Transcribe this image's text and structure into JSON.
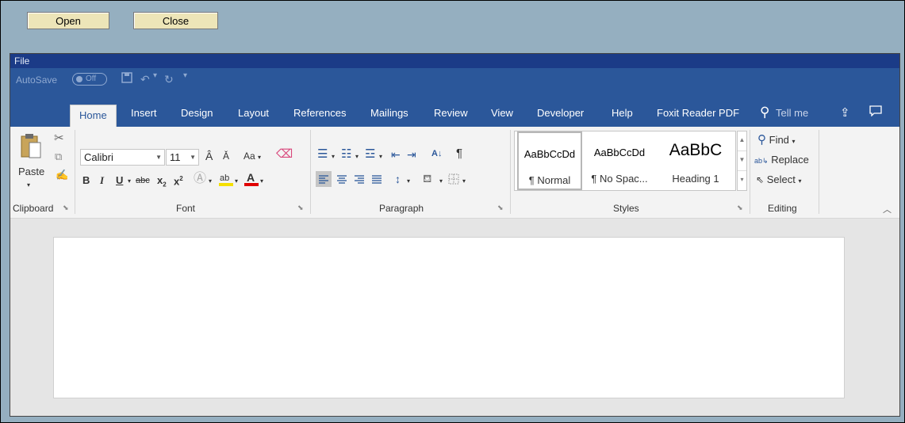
{
  "outer": {
    "open_label": "Open",
    "close_label": "Close"
  },
  "word": {
    "file_label": "File",
    "qat": {
      "autosave_label": "AutoSave",
      "toggle_label": "Off",
      "save_icon": "save-icon",
      "undo_icon": "undo-icon",
      "redo_icon": "redo-icon",
      "customize_icon": "customize-qat-icon"
    },
    "tabs": [
      {
        "label": "Home"
      },
      {
        "label": "Insert"
      },
      {
        "label": "Design"
      },
      {
        "label": "Layout"
      },
      {
        "label": "References"
      },
      {
        "label": "Mailings"
      },
      {
        "label": "Review"
      },
      {
        "label": "View"
      },
      {
        "label": "Developer"
      },
      {
        "label": "Help"
      },
      {
        "label": "Foxit Reader PDF"
      }
    ],
    "tell_me": "Tell me",
    "groups": {
      "clipboard": {
        "label": "Clipboard",
        "paste_label": "Paste"
      },
      "font": {
        "label": "Font",
        "font_name": "Calibri",
        "font_size": "11",
        "change_case": "Aa"
      },
      "paragraph": {
        "label": "Paragraph"
      },
      "styles": {
        "label": "Styles",
        "items": [
          {
            "preview": "AaBbCcDd",
            "name": "¶ Normal"
          },
          {
            "preview": "AaBbCcDd",
            "name": "¶ No Spac..."
          },
          {
            "preview": "AaBbC",
            "name": "Heading 1"
          }
        ]
      },
      "editing": {
        "label": "Editing",
        "find_label": "Find",
        "replace_label": "Replace",
        "select_label": "Select"
      }
    }
  },
  "colors": {
    "frame_bg": "#95afc0",
    "word_blue": "#2b579a",
    "title_bar": "#1b3b87",
    "button_bg": "#ede5b8",
    "highlight_yellow": "#f5e000",
    "font_red": "#e00000"
  }
}
